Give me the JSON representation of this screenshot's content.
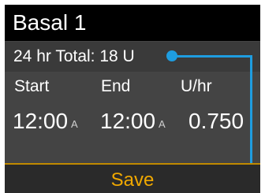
{
  "screen": {
    "title": "Basal 1",
    "total_label": "24 hr Total: 18 U",
    "columns": {
      "start": "Start",
      "end": "End",
      "rate": "U/hr"
    },
    "row": {
      "start_time": "12:00",
      "start_ampm": "A",
      "end_time": "12:00",
      "end_ampm": "A",
      "rate": "0.750"
    },
    "save_label": "Save"
  },
  "colors": {
    "screen_bg": "#444444",
    "title_bg": "#000000",
    "save_text": "#f0a800",
    "callout": "#1e9de0"
  }
}
